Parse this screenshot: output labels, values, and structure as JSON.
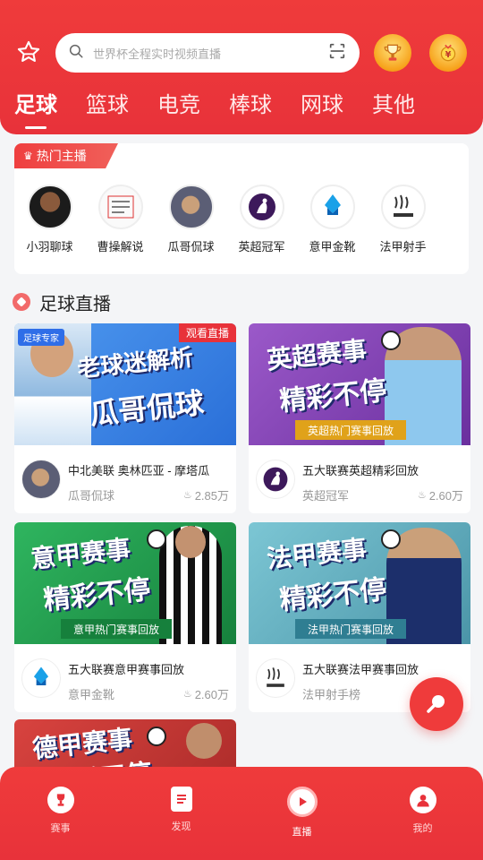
{
  "header": {
    "search_placeholder": "世界杯全程实时视频直播",
    "tabs": [
      {
        "label": "足球",
        "active": true
      },
      {
        "label": "篮球"
      },
      {
        "label": "电竞"
      },
      {
        "label": "棒球"
      },
      {
        "label": "网球"
      },
      {
        "label": "其他"
      }
    ]
  },
  "hot_anchors": {
    "tag": "热门主播",
    "items": [
      {
        "name": "小羽聊球"
      },
      {
        "name": "曹操解说"
      },
      {
        "name": "瓜哥侃球"
      },
      {
        "name": "英超冠军"
      },
      {
        "name": "意甲金靴"
      },
      {
        "name": "法甲射手"
      }
    ]
  },
  "section": {
    "title": "足球直播"
  },
  "streams": [
    {
      "thumb_line1": "老球迷解析",
      "thumb_line2": "瓜哥侃球",
      "badge_expert": "足球专家",
      "badge_live": "观看直播",
      "title": "中北美联 奥林匹亚 - 摩塔瓜",
      "anchor": "瓜哥侃球",
      "views": "2.85万",
      "color": "#3b78e7"
    },
    {
      "thumb_line1": "英超赛事",
      "thumb_line2": "精彩不停",
      "strip": "英超热门赛事回放",
      "title": "五大联赛英超精彩回放",
      "anchor": "英超冠军",
      "views": "2.60万",
      "color": "#7b3fb0"
    },
    {
      "thumb_line1": "意甲赛事",
      "thumb_line2": "精彩不停",
      "strip": "意甲热门赛事回放",
      "title": "五大联赛意甲赛事回放",
      "anchor": "意甲金靴",
      "views": "2.60万",
      "color": "#1f9a4c"
    },
    {
      "thumb_line1": "法甲赛事",
      "thumb_line2": "精彩不停",
      "strip": "法甲热门赛事回放",
      "title": "五大联赛法甲赛事回放",
      "anchor": "法甲射手榜",
      "views": "",
      "color": "#5aa7b8"
    },
    {
      "thumb_line1": "德甲赛事",
      "thumb_line2": "精彩不停",
      "color": "#c0302e"
    }
  ],
  "bottom_nav": [
    {
      "label": "赛事",
      "icon": "trophy-icon"
    },
    {
      "label": "发现",
      "icon": "news-icon"
    },
    {
      "label": "直播",
      "icon": "live-play-icon",
      "active": true
    },
    {
      "label": "我的",
      "icon": "profile-icon"
    }
  ]
}
